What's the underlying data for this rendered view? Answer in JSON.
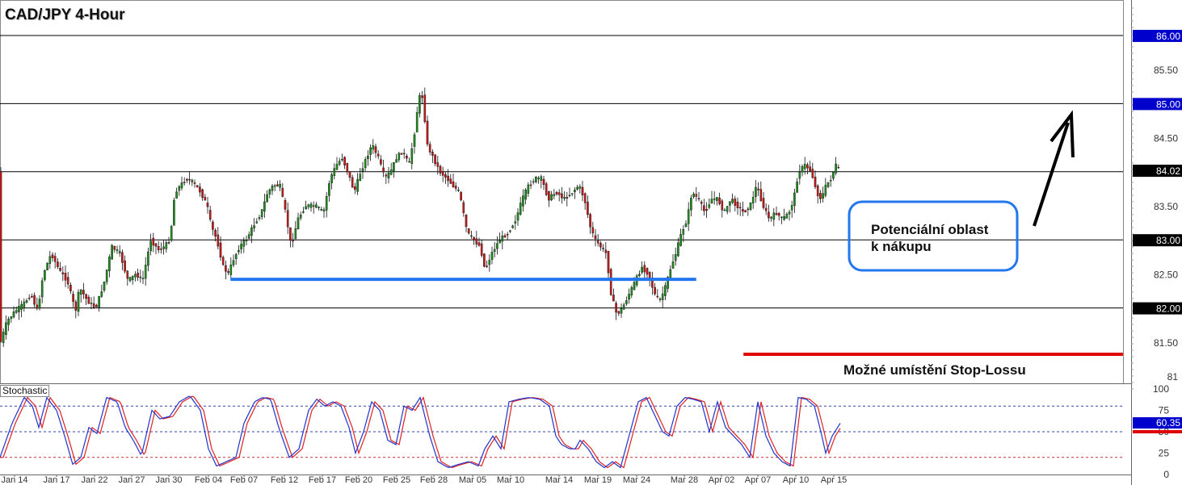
{
  "title": "CAD/JPY 4-Hour",
  "colors": {
    "bull": "#1e8c1e",
    "bear": "#c41a1a",
    "wick": "#111111",
    "support": "#2277ee",
    "stop_loss": "#e00000",
    "stoch_k": "#2233cc",
    "stoch_d": "#dd2222",
    "highlight_blue": "#0000cc",
    "highlight_black": "#000000",
    "highlight_red": "#dd0000"
  },
  "annotations": {
    "buy_zone_label": "Potenciální oblast\nk nákupu",
    "stop_loss_label": "Možné umístění Stop-Lossu",
    "stochastic_label": "Stochastic"
  },
  "chart_data": [
    {
      "type": "candlestick",
      "title": "CAD/JPY 4-Hour",
      "ylim": [
        81.0,
        86.3
      ],
      "grid": false,
      "y_ticks": [
        "86.00",
        "85.50",
        "85.00",
        "84.50",
        "84.02",
        "83.50",
        "83.00",
        "82.50",
        "82.00",
        "81.50",
        "81"
      ],
      "highlighted_ticks": [
        {
          "label": "86.00",
          "value": 86.0,
          "color": "blue"
        },
        {
          "label": "85.00",
          "value": 85.0,
          "color": "blue"
        },
        {
          "label": "84.02",
          "value": 84.02,
          "color": "black"
        },
        {
          "label": "83.00",
          "value": 83.0,
          "color": "black"
        },
        {
          "label": "82.00",
          "value": 82.0,
          "color": "black"
        }
      ],
      "horizontal_levels": [
        86.0,
        85.0,
        84.0,
        83.0,
        82.0
      ],
      "x_ticks": [
        "Jan 14",
        "Jan 17",
        "Jan 22",
        "Jan 27",
        "Jan 30",
        "Feb 04",
        "Feb 07",
        "Feb 12",
        "Feb 17",
        "Feb 20",
        "Feb 25",
        "Feb 28",
        "Mar 05",
        "Mar 10",
        "Mar 14",
        "Mar 19",
        "Mar 24",
        "Mar 28",
        "Apr 02",
        "Apr 07",
        "Apr 10",
        "Apr 15"
      ],
      "price_path": [
        [
          0,
          81.4
        ],
        [
          10,
          81.8
        ],
        [
          20,
          81.95
        ],
        [
          30,
          82.05
        ],
        [
          40,
          82.2
        ],
        [
          48,
          81.95
        ],
        [
          55,
          82.5
        ],
        [
          65,
          82.8
        ],
        [
          75,
          82.55
        ],
        [
          85,
          82.4
        ],
        [
          95,
          81.95
        ],
        [
          100,
          82.3
        ],
        [
          110,
          82.1
        ],
        [
          120,
          82.0
        ],
        [
          130,
          82.35
        ],
        [
          140,
          82.9
        ],
        [
          150,
          82.8
        ],
        [
          160,
          82.4
        ],
        [
          170,
          82.5
        ],
        [
          178,
          82.4
        ],
        [
          188,
          83.0
        ],
        [
          198,
          82.85
        ],
        [
          205,
          82.9
        ],
        [
          212,
          83.0
        ],
        [
          218,
          83.7
        ],
        [
          225,
          83.8
        ],
        [
          232,
          83.9
        ],
        [
          240,
          83.85
        ],
        [
          250,
          83.7
        ],
        [
          258,
          83.5
        ],
        [
          263,
          83.2
        ],
        [
          270,
          83.0
        ],
        [
          278,
          82.6
        ],
        [
          284,
          82.5
        ],
        [
          290,
          82.7
        ],
        [
          298,
          82.9
        ],
        [
          306,
          83.0
        ],
        [
          315,
          83.2
        ],
        [
          325,
          83.4
        ],
        [
          333,
          83.7
        ],
        [
          340,
          83.8
        ],
        [
          348,
          83.8
        ],
        [
          355,
          83.4
        ],
        [
          362,
          82.9
        ],
        [
          370,
          83.3
        ],
        [
          380,
          83.5
        ],
        [
          392,
          83.5
        ],
        [
          402,
          83.4
        ],
        [
          410,
          83.9
        ],
        [
          418,
          84.1
        ],
        [
          425,
          84.2
        ],
        [
          432,
          84.0
        ],
        [
          440,
          83.7
        ],
        [
          448,
          84.0
        ],
        [
          455,
          84.2
        ],
        [
          462,
          84.4
        ],
        [
          470,
          84.2
        ],
        [
          478,
          83.9
        ],
        [
          485,
          84.0
        ],
        [
          492,
          84.2
        ],
        [
          500,
          84.3
        ],
        [
          508,
          84.1
        ],
        [
          515,
          84.6
        ],
        [
          520,
          85.1
        ],
        [
          525,
          85.1
        ],
        [
          530,
          84.4
        ],
        [
          538,
          84.2
        ],
        [
          546,
          84.0
        ],
        [
          555,
          83.9
        ],
        [
          562,
          83.8
        ],
        [
          570,
          83.7
        ],
        [
          575,
          83.4
        ],
        [
          580,
          83.1
        ],
        [
          588,
          83.0
        ],
        [
          596,
          82.9
        ],
        [
          602,
          82.55
        ],
        [
          610,
          82.8
        ],
        [
          620,
          83.0
        ],
        [
          630,
          83.1
        ],
        [
          640,
          83.3
        ],
        [
          648,
          83.6
        ],
        [
          656,
          83.8
        ],
        [
          664,
          83.9
        ],
        [
          672,
          83.9
        ],
        [
          680,
          83.6
        ],
        [
          690,
          83.7
        ],
        [
          700,
          83.6
        ],
        [
          710,
          83.7
        ],
        [
          718,
          83.8
        ],
        [
          725,
          83.6
        ],
        [
          732,
          83.2
        ],
        [
          738,
          83.0
        ],
        [
          745,
          82.9
        ],
        [
          752,
          82.8
        ],
        [
          758,
          82.2
        ],
        [
          765,
          81.9
        ],
        [
          772,
          82.0
        ],
        [
          780,
          82.2
        ],
        [
          788,
          82.4
        ],
        [
          796,
          82.6
        ],
        [
          804,
          82.5
        ],
        [
          812,
          82.2
        ],
        [
          818,
          82.1
        ],
        [
          825,
          82.3
        ],
        [
          832,
          82.6
        ],
        [
          838,
          82.8
        ],
        [
          845,
          83.1
        ],
        [
          852,
          83.3
        ],
        [
          858,
          83.7
        ],
        [
          866,
          83.6
        ],
        [
          874,
          83.4
        ],
        [
          882,
          83.6
        ],
        [
          890,
          83.6
        ],
        [
          898,
          83.4
        ],
        [
          906,
          83.6
        ],
        [
          914,
          83.5
        ],
        [
          922,
          83.4
        ],
        [
          930,
          83.5
        ],
        [
          938,
          83.8
        ],
        [
          946,
          83.5
        ],
        [
          954,
          83.3
        ],
        [
          962,
          83.4
        ],
        [
          970,
          83.3
        ],
        [
          978,
          83.4
        ],
        [
          984,
          83.6
        ],
        [
          990,
          84.0
        ],
        [
          998,
          84.1
        ],
        [
          1006,
          84.0
        ],
        [
          1012,
          83.7
        ],
        [
          1018,
          83.6
        ],
        [
          1024,
          83.8
        ],
        [
          1030,
          83.9
        ],
        [
          1036,
          84.1
        ],
        [
          1041,
          84.0
        ]
      ],
      "series": [
        {
          "name": "",
          "style": "support-line",
          "x": [
            0.195,
            0.589
          ],
          "y": [
            82.42,
            82.42
          ]
        },
        {
          "name": "",
          "style": "stop-loss-line",
          "x": [
            0.629,
            0.95
          ],
          "y": [
            81.32,
            81.32
          ]
        }
      ]
    },
    {
      "type": "line",
      "title": "Stochastic",
      "ylim": [
        0,
        100
      ],
      "y_ticks": [
        "100",
        "75",
        "50",
        "25",
        "0"
      ],
      "current_value": "60.35",
      "levels": [
        80,
        50,
        20
      ],
      "stoch_path": [
        [
          0,
          20
        ],
        [
          15,
          60
        ],
        [
          30,
          90
        ],
        [
          40,
          80
        ],
        [
          48,
          55
        ],
        [
          58,
          90
        ],
        [
          70,
          75
        ],
        [
          80,
          45
        ],
        [
          90,
          12
        ],
        [
          100,
          20
        ],
        [
          110,
          55
        ],
        [
          120,
          48
        ],
        [
          132,
          90
        ],
        [
          145,
          85
        ],
        [
          155,
          55
        ],
        [
          165,
          40
        ],
        [
          175,
          22
        ],
        [
          188,
          75
        ],
        [
          198,
          65
        ],
        [
          210,
          68
        ],
        [
          222,
          85
        ],
        [
          235,
          92
        ],
        [
          248,
          75
        ],
        [
          258,
          30
        ],
        [
          268,
          10
        ],
        [
          280,
          15
        ],
        [
          292,
          20
        ],
        [
          302,
          60
        ],
        [
          315,
          85
        ],
        [
          325,
          90
        ],
        [
          335,
          88
        ],
        [
          345,
          55
        ],
        [
          358,
          20
        ],
        [
          370,
          30
        ],
        [
          382,
          75
        ],
        [
          392,
          88
        ],
        [
          402,
          80
        ],
        [
          412,
          85
        ],
        [
          422,
          80
        ],
        [
          432,
          55
        ],
        [
          440,
          25
        ],
        [
          450,
          50
        ],
        [
          460,
          85
        ],
        [
          470,
          75
        ],
        [
          480,
          40
        ],
        [
          490,
          35
        ],
        [
          500,
          80
        ],
        [
          510,
          75
        ],
        [
          520,
          90
        ],
        [
          532,
          45
        ],
        [
          542,
          15
        ],
        [
          555,
          8
        ],
        [
          568,
          12
        ],
        [
          580,
          15
        ],
        [
          592,
          10
        ],
        [
          600,
          30
        ],
        [
          610,
          45
        ],
        [
          620,
          30
        ],
        [
          630,
          85
        ],
        [
          642,
          88
        ],
        [
          655,
          90
        ],
        [
          668,
          88
        ],
        [
          680,
          80
        ],
        [
          688,
          45
        ],
        [
          695,
          35
        ],
        [
          705,
          30
        ],
        [
          712,
          30
        ],
        [
          718,
          40
        ],
        [
          728,
          30
        ],
        [
          738,
          15
        ],
        [
          748,
          8
        ],
        [
          758,
          15
        ],
        [
          768,
          8
        ],
        [
          780,
          50
        ],
        [
          790,
          85
        ],
        [
          800,
          90
        ],
        [
          810,
          70
        ],
        [
          820,
          50
        ],
        [
          828,
          45
        ],
        [
          838,
          80
        ],
        [
          848,
          90
        ],
        [
          858,
          88
        ],
        [
          868,
          85
        ],
        [
          878,
          50
        ],
        [
          888,
          85
        ],
        [
          898,
          55
        ],
        [
          908,
          45
        ],
        [
          918,
          35
        ],
        [
          928,
          20
        ],
        [
          938,
          85
        ],
        [
          948,
          45
        ],
        [
          958,
          25
        ],
        [
          968,
          15
        ],
        [
          978,
          10
        ],
        [
          988,
          90
        ],
        [
          998,
          88
        ],
        [
          1008,
          80
        ],
        [
          1016,
          50
        ],
        [
          1022,
          25
        ],
        [
          1030,
          45
        ],
        [
          1040,
          60
        ]
      ]
    }
  ]
}
